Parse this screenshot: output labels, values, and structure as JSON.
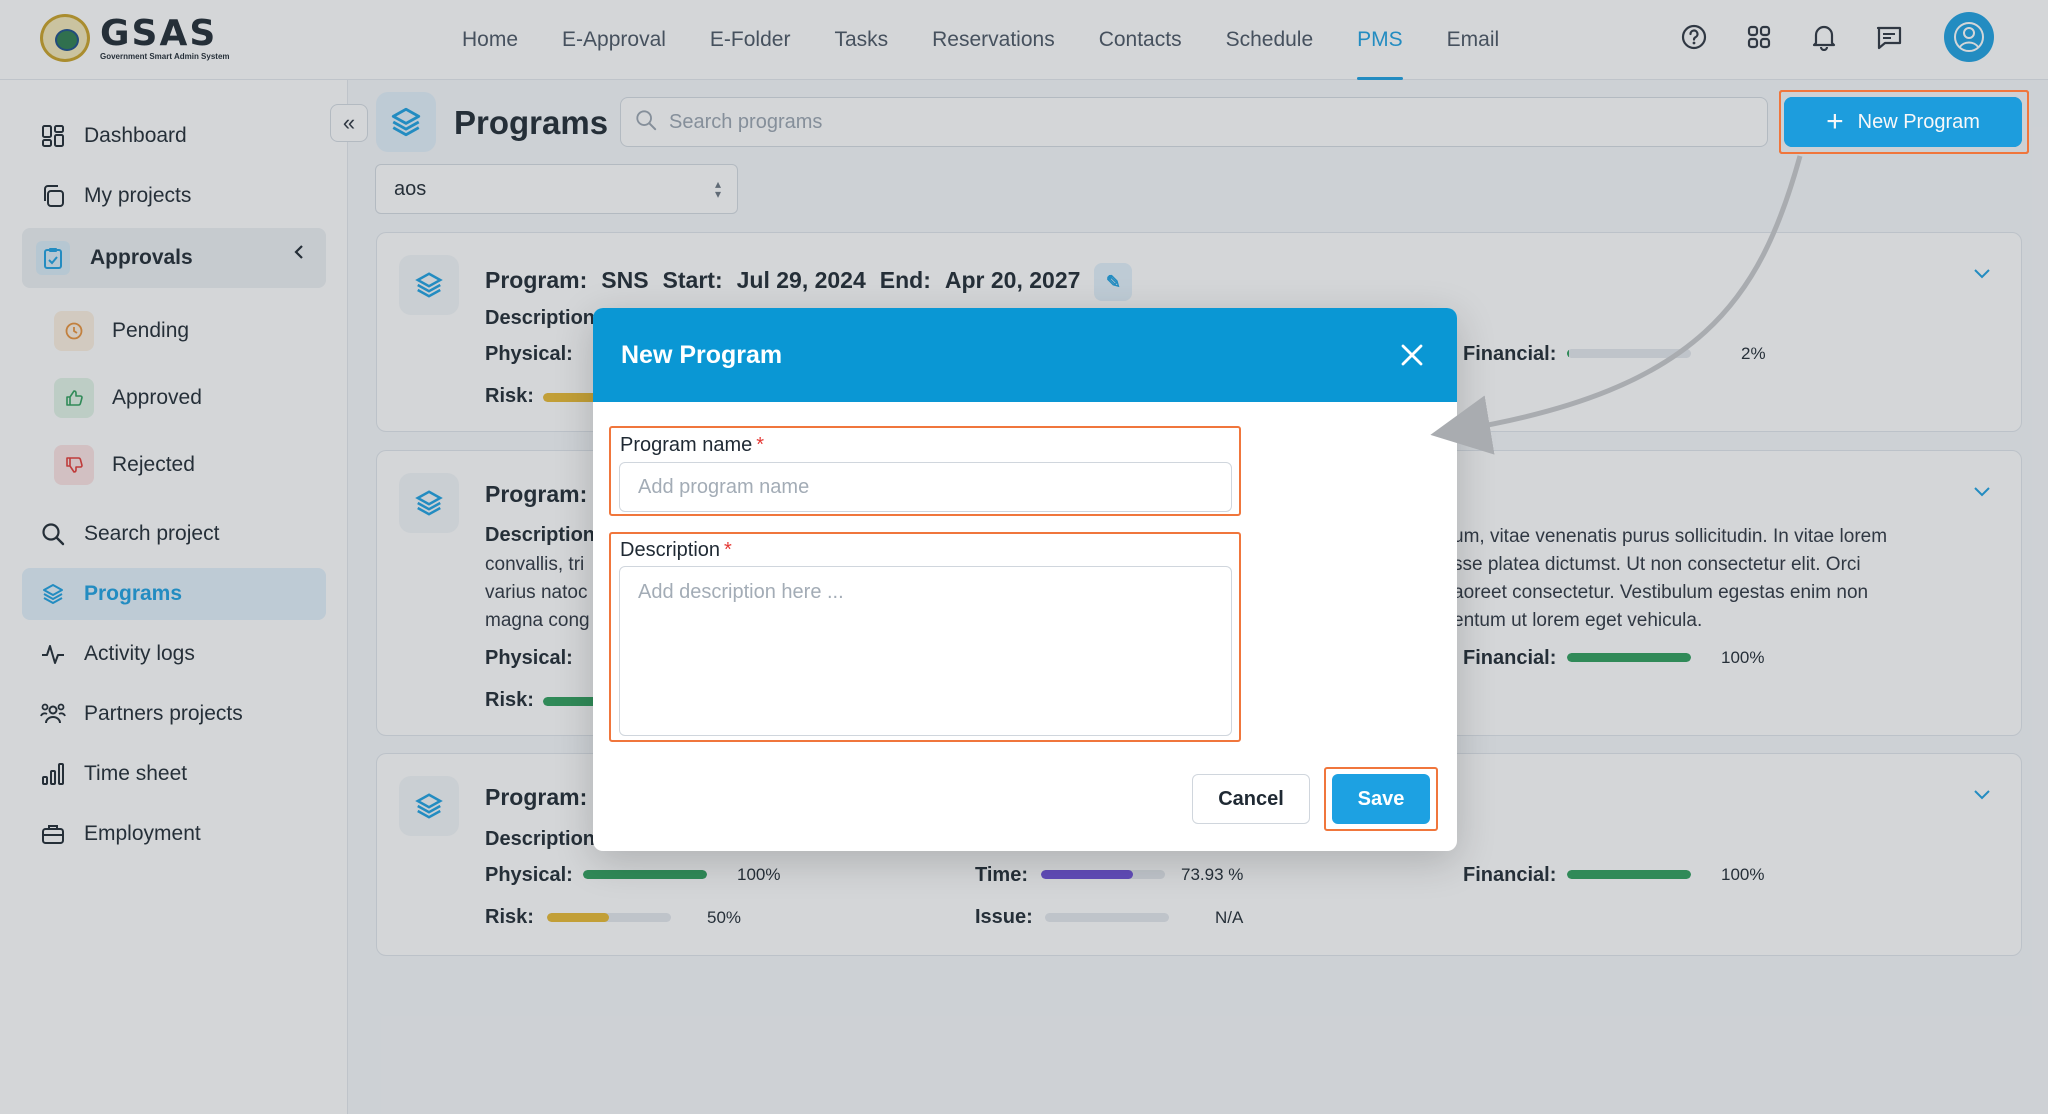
{
  "logo": {
    "name": "GSAS",
    "subtitle": "Government Smart Admin System"
  },
  "nav": {
    "items": [
      {
        "label": "Home"
      },
      {
        "label": "E-Approval"
      },
      {
        "label": "E-Folder"
      },
      {
        "label": "Tasks"
      },
      {
        "label": "Reservations"
      },
      {
        "label": "Contacts"
      },
      {
        "label": "Schedule"
      },
      {
        "label": "PMS"
      },
      {
        "label": "Email"
      }
    ],
    "active": "PMS"
  },
  "top_icons": [
    "help-icon",
    "apps-grid-icon",
    "bell-icon",
    "chat-icon",
    "user-avatar-icon"
  ],
  "sidebar": {
    "dashboard": "Dashboard",
    "my_projects": "My projects",
    "approvals": "Approvals",
    "pending": "Pending",
    "approved": "Approved",
    "rejected": "Rejected",
    "search_project": "Search project",
    "programs": "Programs",
    "activity_logs": "Activity logs",
    "partners_projects": "Partners projects",
    "time_sheet": "Time sheet",
    "employment": "Employment"
  },
  "main": {
    "title": "Programs",
    "search_placeholder": "Search programs",
    "new_program_label": "New Program",
    "filter_value": "aos"
  },
  "cards": [
    {
      "program_label": "Program:",
      "program_name": "SNS",
      "start_label": "Start:",
      "start_date": "Jul 29, 2024",
      "end_label": "End:",
      "end_date": "Apr 20, 2027",
      "description_label": "Description",
      "physical_label": "Physical:",
      "risk_label": "Risk:",
      "financial_label": "Financial:",
      "financial_pct": "2%",
      "financial_value": 0.02
    },
    {
      "program_label": "Program:",
      "description_label": "Description",
      "description_left": [
        "convallis, tri",
        "varius natoc",
        "magna cong"
      ],
      "description_right": [
        "um, vitae venenatis purus sollicitudin. In vitae lorem",
        "sse platea dictumst. Ut non consectetur elit. Orci",
        "aoreet consectetur. Vestibulum egestas enim non",
        "entum ut lorem eget vehicula."
      ],
      "physical_label": "Physical:",
      "risk_label": "Risk:",
      "financial_label": "Financial:",
      "financial_pct": "100%",
      "financial_value": 1.0
    },
    {
      "program_label": "Program:",
      "description_label": "Description",
      "physical_label": "Physical:",
      "physical_pct": "100%",
      "physical_value": 1.0,
      "time_label": "Time:",
      "time_pct": "73.93 %",
      "time_value": 0.7393,
      "financial_label": "Financial:",
      "financial_pct": "100%",
      "financial_value": 1.0,
      "risk_label": "Risk:",
      "risk_pct": "50%",
      "risk_value": 0.5,
      "issue_label": "Issue:",
      "issue_value": "N/A"
    }
  ],
  "modal": {
    "title": "New Program",
    "name_label": "Program name",
    "name_placeholder": "Add program name",
    "description_label": "Description",
    "description_placeholder": "Add description here ...",
    "required_mark": "*",
    "cancel_label": "Cancel",
    "save_label": "Save"
  },
  "colors": {
    "accent": "#1da1e2",
    "modal_header": "#0a97d4",
    "highlight": "#f0763c",
    "bar_green": "#2e9e5b",
    "bar_yellow": "#e8b931",
    "bar_purple": "#6c4fd6",
    "bar_red": "#e53935"
  }
}
